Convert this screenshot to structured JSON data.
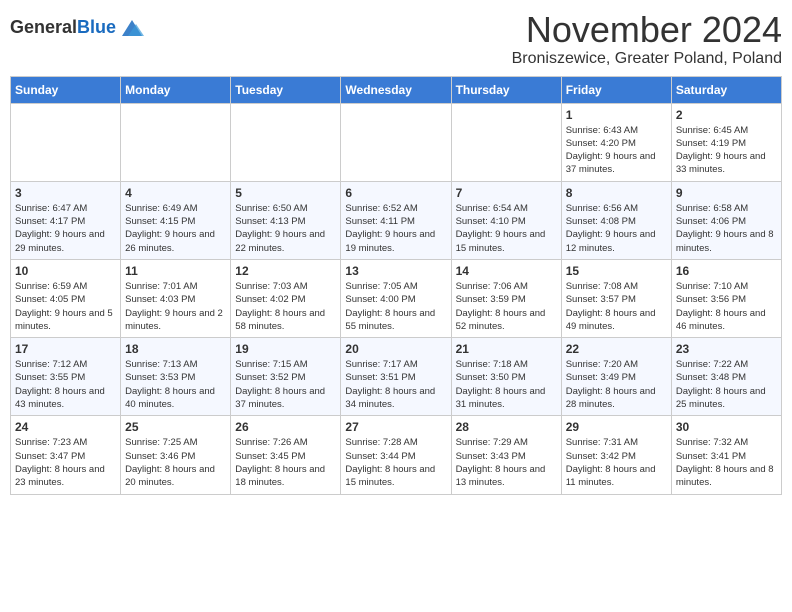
{
  "logo": {
    "general": "General",
    "blue": "Blue"
  },
  "header": {
    "month": "November 2024",
    "location": "Broniszewice, Greater Poland, Poland"
  },
  "weekdays": [
    "Sunday",
    "Monday",
    "Tuesday",
    "Wednesday",
    "Thursday",
    "Friday",
    "Saturday"
  ],
  "weeks": [
    [
      {
        "day": "",
        "info": ""
      },
      {
        "day": "",
        "info": ""
      },
      {
        "day": "",
        "info": ""
      },
      {
        "day": "",
        "info": ""
      },
      {
        "day": "",
        "info": ""
      },
      {
        "day": "1",
        "info": "Sunrise: 6:43 AM\nSunset: 4:20 PM\nDaylight: 9 hours and 37 minutes."
      },
      {
        "day": "2",
        "info": "Sunrise: 6:45 AM\nSunset: 4:19 PM\nDaylight: 9 hours and 33 minutes."
      }
    ],
    [
      {
        "day": "3",
        "info": "Sunrise: 6:47 AM\nSunset: 4:17 PM\nDaylight: 9 hours and 29 minutes."
      },
      {
        "day": "4",
        "info": "Sunrise: 6:49 AM\nSunset: 4:15 PM\nDaylight: 9 hours and 26 minutes."
      },
      {
        "day": "5",
        "info": "Sunrise: 6:50 AM\nSunset: 4:13 PM\nDaylight: 9 hours and 22 minutes."
      },
      {
        "day": "6",
        "info": "Sunrise: 6:52 AM\nSunset: 4:11 PM\nDaylight: 9 hours and 19 minutes."
      },
      {
        "day": "7",
        "info": "Sunrise: 6:54 AM\nSunset: 4:10 PM\nDaylight: 9 hours and 15 minutes."
      },
      {
        "day": "8",
        "info": "Sunrise: 6:56 AM\nSunset: 4:08 PM\nDaylight: 9 hours and 12 minutes."
      },
      {
        "day": "9",
        "info": "Sunrise: 6:58 AM\nSunset: 4:06 PM\nDaylight: 9 hours and 8 minutes."
      }
    ],
    [
      {
        "day": "10",
        "info": "Sunrise: 6:59 AM\nSunset: 4:05 PM\nDaylight: 9 hours and 5 minutes."
      },
      {
        "day": "11",
        "info": "Sunrise: 7:01 AM\nSunset: 4:03 PM\nDaylight: 9 hours and 2 minutes."
      },
      {
        "day": "12",
        "info": "Sunrise: 7:03 AM\nSunset: 4:02 PM\nDaylight: 8 hours and 58 minutes."
      },
      {
        "day": "13",
        "info": "Sunrise: 7:05 AM\nSunset: 4:00 PM\nDaylight: 8 hours and 55 minutes."
      },
      {
        "day": "14",
        "info": "Sunrise: 7:06 AM\nSunset: 3:59 PM\nDaylight: 8 hours and 52 minutes."
      },
      {
        "day": "15",
        "info": "Sunrise: 7:08 AM\nSunset: 3:57 PM\nDaylight: 8 hours and 49 minutes."
      },
      {
        "day": "16",
        "info": "Sunrise: 7:10 AM\nSunset: 3:56 PM\nDaylight: 8 hours and 46 minutes."
      }
    ],
    [
      {
        "day": "17",
        "info": "Sunrise: 7:12 AM\nSunset: 3:55 PM\nDaylight: 8 hours and 43 minutes."
      },
      {
        "day": "18",
        "info": "Sunrise: 7:13 AM\nSunset: 3:53 PM\nDaylight: 8 hours and 40 minutes."
      },
      {
        "day": "19",
        "info": "Sunrise: 7:15 AM\nSunset: 3:52 PM\nDaylight: 8 hours and 37 minutes."
      },
      {
        "day": "20",
        "info": "Sunrise: 7:17 AM\nSunset: 3:51 PM\nDaylight: 8 hours and 34 minutes."
      },
      {
        "day": "21",
        "info": "Sunrise: 7:18 AM\nSunset: 3:50 PM\nDaylight: 8 hours and 31 minutes."
      },
      {
        "day": "22",
        "info": "Sunrise: 7:20 AM\nSunset: 3:49 PM\nDaylight: 8 hours and 28 minutes."
      },
      {
        "day": "23",
        "info": "Sunrise: 7:22 AM\nSunset: 3:48 PM\nDaylight: 8 hours and 25 minutes."
      }
    ],
    [
      {
        "day": "24",
        "info": "Sunrise: 7:23 AM\nSunset: 3:47 PM\nDaylight: 8 hours and 23 minutes."
      },
      {
        "day": "25",
        "info": "Sunrise: 7:25 AM\nSunset: 3:46 PM\nDaylight: 8 hours and 20 minutes."
      },
      {
        "day": "26",
        "info": "Sunrise: 7:26 AM\nSunset: 3:45 PM\nDaylight: 8 hours and 18 minutes."
      },
      {
        "day": "27",
        "info": "Sunrise: 7:28 AM\nSunset: 3:44 PM\nDaylight: 8 hours and 15 minutes."
      },
      {
        "day": "28",
        "info": "Sunrise: 7:29 AM\nSunset: 3:43 PM\nDaylight: 8 hours and 13 minutes."
      },
      {
        "day": "29",
        "info": "Sunrise: 7:31 AM\nSunset: 3:42 PM\nDaylight: 8 hours and 11 minutes."
      },
      {
        "day": "30",
        "info": "Sunrise: 7:32 AM\nSunset: 3:41 PM\nDaylight: 8 hours and 8 minutes."
      }
    ]
  ]
}
